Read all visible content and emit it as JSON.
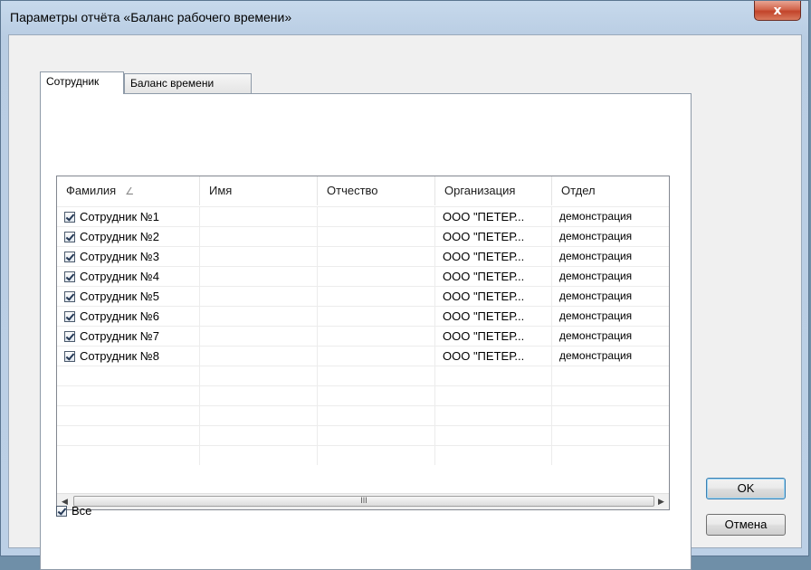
{
  "window": {
    "title": "Параметры отчёта «Баланс рабочего времени»",
    "close_label": "x"
  },
  "tabs": [
    {
      "label": "Сотрудник",
      "active": true
    },
    {
      "label": "Баланс времени",
      "active": false
    }
  ],
  "grid": {
    "columns": [
      "Фамилия",
      "Имя",
      "Отчество",
      "Организация",
      "Отдел"
    ],
    "sort_indicator": "∠",
    "rows": [
      {
        "checked": true,
        "surname": "Сотрудник №1",
        "name": "",
        "patronymic": "",
        "org": "ООО \"ПЕТЕР...",
        "dept": "демонстрация"
      },
      {
        "checked": true,
        "surname": "Сотрудник №2",
        "name": "",
        "patronymic": "",
        "org": "ООО \"ПЕТЕР...",
        "dept": "демонстрация"
      },
      {
        "checked": true,
        "surname": "Сотрудник №3",
        "name": "",
        "patronymic": "",
        "org": "ООО \"ПЕТЕР...",
        "dept": "демонстрация"
      },
      {
        "checked": true,
        "surname": "Сотрудник №4",
        "name": "",
        "patronymic": "",
        "org": "ООО \"ПЕТЕР...",
        "dept": "демонстрация"
      },
      {
        "checked": true,
        "surname": "Сотрудник №5",
        "name": "",
        "patronymic": "",
        "org": "ООО \"ПЕТЕР...",
        "dept": "демонстрация"
      },
      {
        "checked": true,
        "surname": "Сотрудник №6",
        "name": "",
        "patronymic": "",
        "org": "ООО \"ПЕТЕР...",
        "dept": "демонстрация"
      },
      {
        "checked": true,
        "surname": "Сотрудник №7",
        "name": "",
        "patronymic": "",
        "org": "ООО \"ПЕТЕР...",
        "dept": "демонстрация"
      },
      {
        "checked": true,
        "surname": "Сотрудник №8",
        "name": "",
        "patronymic": "",
        "org": "ООО \"ПЕТЕР...",
        "dept": "демонстрация"
      }
    ],
    "scroll_left": "◀",
    "scroll_right": "▶",
    "scroll_grip": "III"
  },
  "select_all": {
    "label": "Все",
    "checked": true
  },
  "buttons": {
    "ok": "OK",
    "cancel": "Отмена"
  }
}
